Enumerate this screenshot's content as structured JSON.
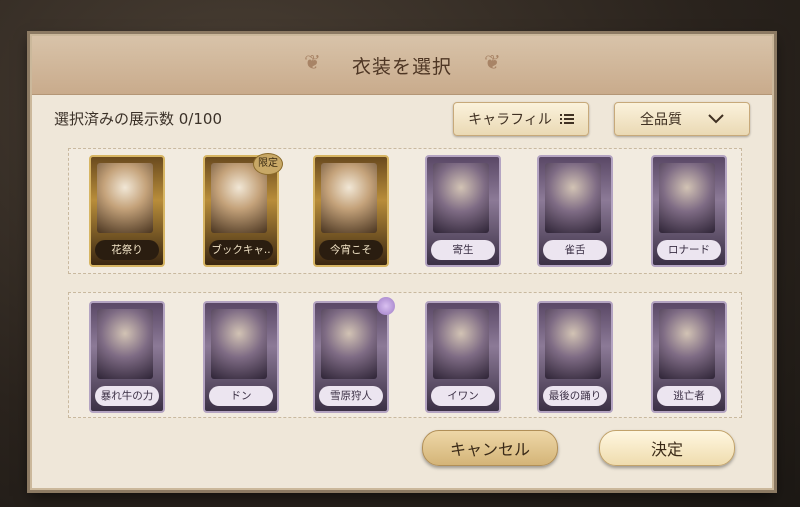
{
  "dialog": {
    "title": "衣装を選択",
    "counter": "選択済みの展示数 0/100",
    "filter_label": "キャラフィル",
    "quality_label": "全品質"
  },
  "row1": [
    {
      "label": "花祭り",
      "tier": "gold"
    },
    {
      "label": "ブックキャ..",
      "tier": "gold",
      "badge": "限定"
    },
    {
      "label": "今宵こそ",
      "tier": "gold"
    },
    {
      "label": "寄生",
      "tier": "purple"
    },
    {
      "label": "雀舌",
      "tier": "purple"
    },
    {
      "label": "ロナード",
      "tier": "purple"
    }
  ],
  "row2": [
    {
      "label": "暴れ牛の力",
      "tier": "purple"
    },
    {
      "label": "ドン",
      "tier": "purple"
    },
    {
      "label": "雪原狩人",
      "tier": "purple"
    },
    {
      "label": "イワン",
      "tier": "purple"
    },
    {
      "label": "最後の踊り",
      "tier": "purple"
    },
    {
      "label": "逃亡者",
      "tier": "purple"
    }
  ],
  "buttons": {
    "cancel": "キャンセル",
    "confirm": "決定"
  },
  "colors": {
    "gold_frame": "#d7b563",
    "purple_frame": "#b4a4c2",
    "panel_bg": "#efe7d9"
  },
  "icons": {
    "filter": "list-icon",
    "quality": "chevron-down-icon",
    "ornament": "leaf-ornament-icon"
  }
}
